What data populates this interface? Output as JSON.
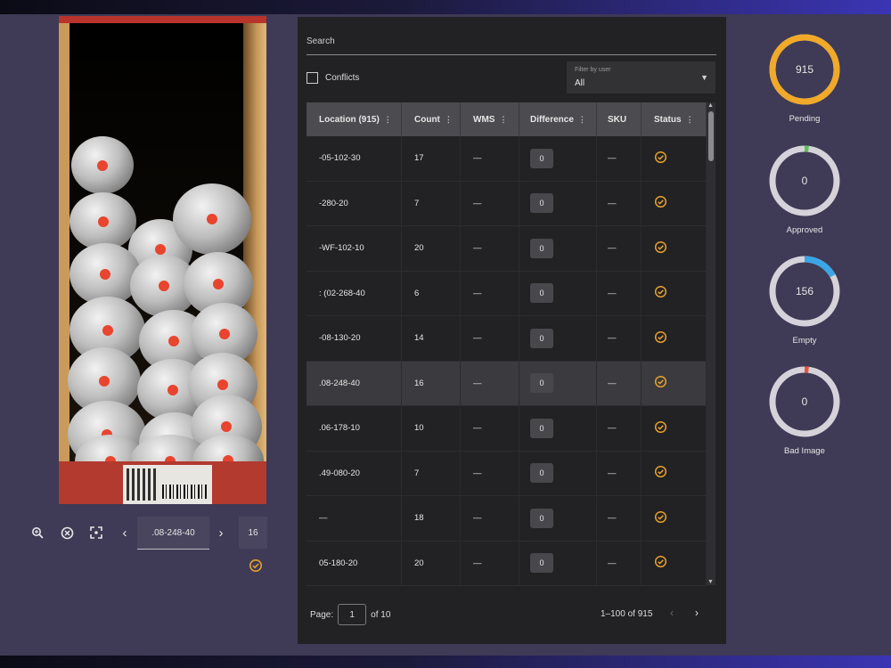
{
  "viewer": {
    "location_value": ".08-248-40",
    "count_value": "16",
    "controls": [
      "zoom-in-icon",
      "reset-icon",
      "fit-screen-icon",
      "chevron-left-icon",
      "chevron-right-icon"
    ]
  },
  "table_panel": {
    "search_placeholder": "Search",
    "conflicts_label": "Conflicts",
    "filter": {
      "label": "Filter by user",
      "value": "All"
    },
    "columns": [
      "Location (915)",
      "Count",
      "WMS",
      "Difference",
      "SKU",
      "Status"
    ],
    "rows": [
      {
        "location": "-05-102-30",
        "count": "17",
        "wms": "—",
        "difference": "0",
        "sku": "—"
      },
      {
        "location": "-280-20",
        "count": "7",
        "wms": "—",
        "difference": "0",
        "sku": "—"
      },
      {
        "location": "-WF-102-10",
        "count": "20",
        "wms": "—",
        "difference": "0",
        "sku": "—"
      },
      {
        "location": ": (02-268-40",
        "count": "6",
        "wms": "—",
        "difference": "0",
        "sku": "—"
      },
      {
        "location": "-08-130-20",
        "count": "14",
        "wms": "—",
        "difference": "0",
        "sku": "—"
      },
      {
        "location": ".08-248-40",
        "count": "16",
        "wms": "—",
        "difference": "0",
        "sku": "—",
        "selected": true
      },
      {
        "location": ".06-178-10",
        "count": "10",
        "wms": "—",
        "difference": "0",
        "sku": "—"
      },
      {
        "location": ".49-080-20",
        "count": "7",
        "wms": "—",
        "difference": "0",
        "sku": "—"
      },
      {
        "location": "—",
        "count": "18",
        "wms": "—",
        "difference": "0",
        "sku": "—"
      },
      {
        "location": "05-180-20",
        "count": "20",
        "wms": "—",
        "difference": "0",
        "sku": "—"
      }
    ],
    "pagination": {
      "page_label": "Page:",
      "page_value": "1",
      "of_label": "of 10",
      "range": "1–100 of 915"
    }
  },
  "stats": [
    {
      "value": "915",
      "label": "Pending",
      "color": "#f0a928",
      "fraction": 1.0
    },
    {
      "value": "0",
      "label": "Approved",
      "color": "#5cc15a",
      "fraction": 0.02
    },
    {
      "value": "156",
      "label": "Empty",
      "color": "#3aa6e8",
      "fraction": 0.17
    },
    {
      "value": "0",
      "label": "Bad Image",
      "color": "#e8553c",
      "fraction": 0.02
    }
  ],
  "colors": {
    "status_ok": "#e6a12b",
    "track": "#d6d2da",
    "panel": "#222224"
  }
}
